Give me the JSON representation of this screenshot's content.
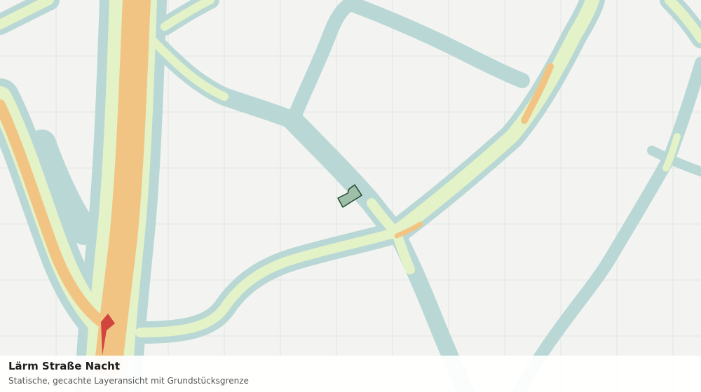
{
  "map": {
    "layer": "noise-road-night",
    "colors": {
      "background": "#f3f4f2",
      "grid": "#e1e3e0",
      "band_outer": "#b9d8d5",
      "band_middle": "#e4f2c8",
      "band_inner": "#f2c484",
      "band_peak": "#d2453f",
      "parcel_fill": "#9fbfa8",
      "parcel_outline": "#1f4a2e"
    }
  },
  "caption": {
    "title": "Lärm Straße Nacht",
    "subtitle": "Statische, gecachte Layeransicht mit Grundstücksgrenze"
  }
}
